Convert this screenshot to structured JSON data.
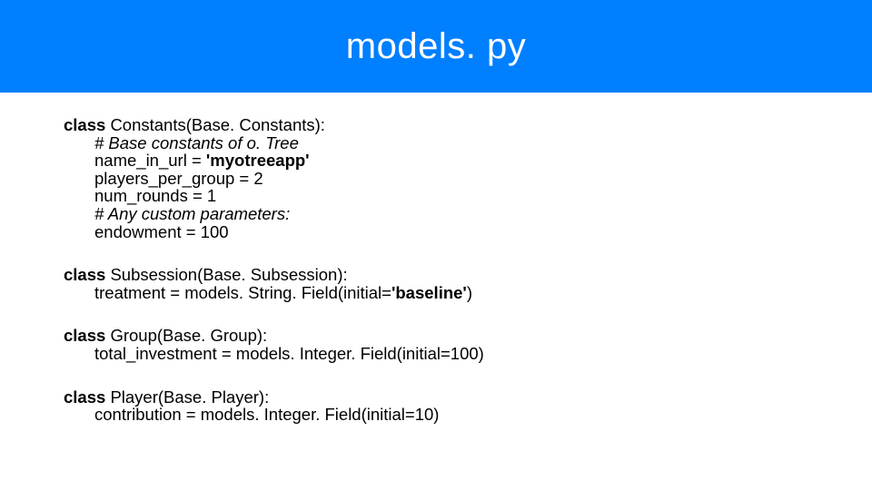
{
  "title": "models. py",
  "kw_class": "class",
  "blocks": {
    "constants": {
      "head": "Constants(Base. Constants):",
      "comment1": "# Base constants of o. Tree",
      "name_in_url_lhs": "name_in_url = ",
      "name_in_url_val": "'myotreeapp'",
      "players": "players_per_group = 2",
      "rounds": "num_rounds = 1",
      "comment2": "# Any custom parameters:",
      "endowment": "endowment = 100"
    },
    "subsession": {
      "head": "Subsession(Base. Subsession):",
      "treatment_lhs": "treatment = models. String. Field(initial=",
      "treatment_val": "'baseline'",
      "treatment_end": ")"
    },
    "group": {
      "head": "Group(Base. Group):",
      "total_investment": "total_investment = models. Integer. Field(initial=100)"
    },
    "player": {
      "head": "Player(Base. Player):",
      "contribution": "contribution = models. Integer. Field(initial=10)"
    }
  }
}
